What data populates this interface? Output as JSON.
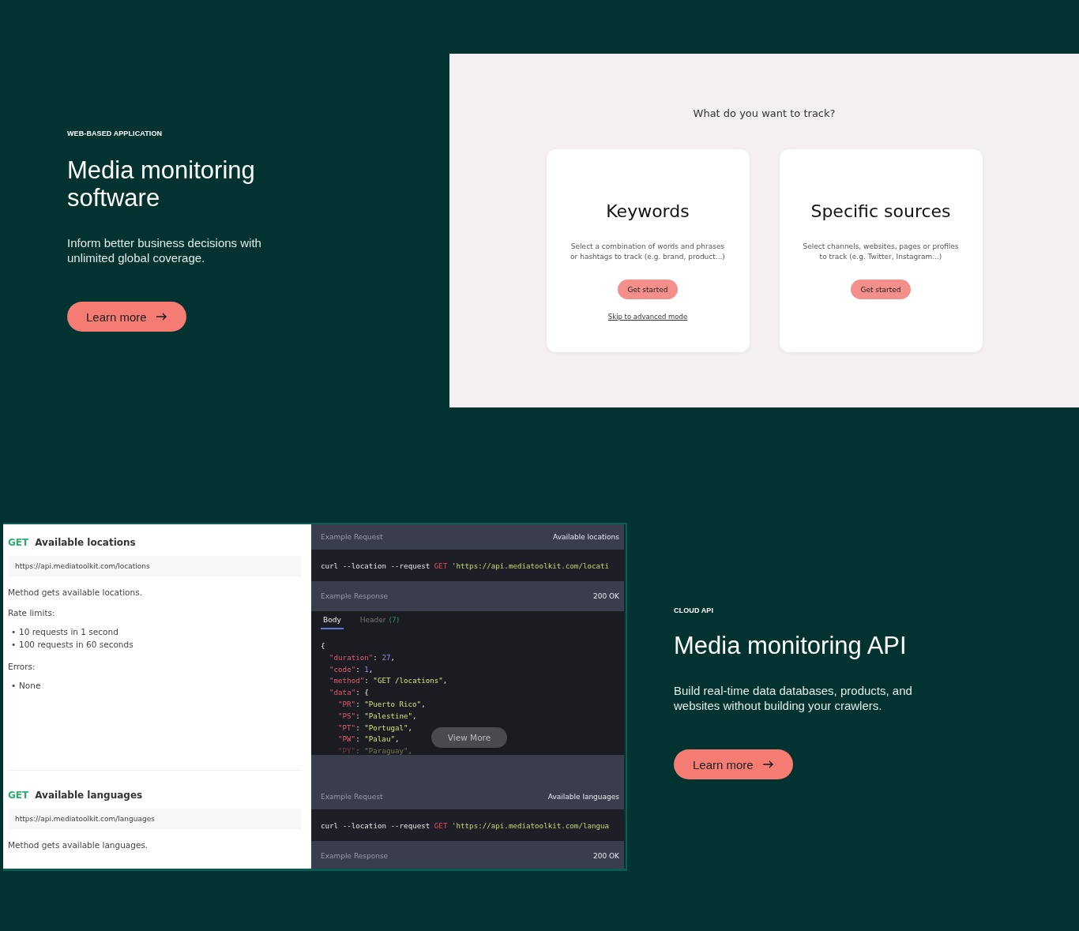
{
  "hero": {
    "eyebrow": "WEB-BASED APPLICATION",
    "title": "Media monitoring software",
    "description": "Inform better business decisions with unlimited global coverage.",
    "button": "Learn more"
  },
  "app_screenshot": {
    "question": "What do you want to track?",
    "cards": [
      {
        "title": "Keywords",
        "description": "Select a combination of words and phrases or hashtags to track (e.g. brand, product...)",
        "button": "Get started",
        "link": "Skip to advanced mode"
      },
      {
        "title": "Specific sources",
        "description": "Select channels, websites, pages or profiles to track (e.g. Twitter, Instagram...)",
        "button": "Get started"
      }
    ]
  },
  "api_screenshot": {
    "endpoints": [
      {
        "method": "GET",
        "name": "Available locations",
        "url": "https://api.mediatoolkit.com/locations",
        "description": "Method gets available locations.",
        "rate_limits_label": "Rate limits:",
        "rate_limits": [
          {
            "bullet": "•",
            "text": "10 requests in 1 second"
          },
          {
            "bullet": "•",
            "text": "100 requests in 60 seconds"
          }
        ],
        "errors_label": "Errors:",
        "errors": [
          {
            "bullet": "•",
            "text": "None"
          }
        ]
      },
      {
        "method": "GET",
        "name": "Available languages",
        "url": "https://api.mediatoolkit.com/languages",
        "description": "Method gets available languages."
      }
    ],
    "examples": [
      {
        "request_label": "Example Request",
        "request_name": "Available locations",
        "curl": "curl --location --request",
        "curl_method": "GET",
        "curl_url": "'https://api.mediatoolkit.com/locati",
        "response_label": "Example Response",
        "status": "200 OK",
        "tabs": [
          {
            "label": "Body",
            "selected": true
          },
          {
            "label": "Header",
            "count": "(7)",
            "selected": false
          }
        ],
        "code": [
          [
            {
              "t": "{",
              "kind": "punct"
            }
          ],
          [
            {
              "t": "\"duration\"",
              "kind": "key"
            },
            {
              "t": ": ",
              "kind": "punct"
            },
            {
              "t": "27",
              "kind": "number"
            },
            {
              "t": ",",
              "kind": "punct"
            }
          ],
          [
            {
              "t": "\"code\"",
              "kind": "key"
            },
            {
              "t": ": ",
              "kind": "punct"
            },
            {
              "t": "1",
              "kind": "number"
            },
            {
              "t": ",",
              "kind": "punct"
            }
          ],
          [
            {
              "t": "\"method\"",
              "kind": "key"
            },
            {
              "t": ": ",
              "kind": "punct"
            },
            {
              "t": "\"GET /locations\"",
              "kind": "string"
            },
            {
              "t": ",",
              "kind": "punct"
            }
          ],
          [
            {
              "t": "\"data\"",
              "kind": "key"
            },
            {
              "t": ": {",
              "kind": "punct"
            }
          ],
          [
            {
              "t": "\"PR\"",
              "kind": "key"
            },
            {
              "t": ": ",
              "kind": "punct"
            },
            {
              "t": "\"Puerto Rico\"",
              "kind": "string"
            },
            {
              "t": ",",
              "kind": "punct"
            }
          ],
          [
            {
              "t": "\"PS\"",
              "kind": "key"
            },
            {
              "t": ": ",
              "kind": "punct"
            },
            {
              "t": "\"Palestine\"",
              "kind": "string"
            },
            {
              "t": ",",
              "kind": "punct"
            }
          ],
          [
            {
              "t": "\"PT\"",
              "kind": "key"
            },
            {
              "t": ": ",
              "kind": "punct"
            },
            {
              "t": "\"Portugal\"",
              "kind": "string"
            },
            {
              "t": ",",
              "kind": "punct"
            }
          ],
          [
            {
              "t": "\"PW\"",
              "kind": "key"
            },
            {
              "t": ": ",
              "kind": "punct"
            },
            {
              "t": "\"Palau\"",
              "kind": "string"
            },
            {
              "t": ",",
              "kind": "punct"
            }
          ],
          [
            {
              "t": "\"PY\"",
              "kind": "key"
            },
            {
              "t": ": ",
              "kind": "punct"
            },
            {
              "t": "\"Paraguay\"",
              "kind": "string"
            },
            {
              "t": ",",
              "kind": "punct"
            }
          ]
        ],
        "view_more": "View More"
      },
      {
        "request_label": "Example Request",
        "request_name": "Available languages",
        "curl": "curl --location --request",
        "curl_method": "GET",
        "curl_url": "'https://api.mediatoolkit.com/langua",
        "response_label": "Example Response",
        "status": "200 OK"
      }
    ]
  },
  "api_section": {
    "eyebrow": "CLOUD API",
    "title": "Media monitoring API",
    "description": "Build real-time data databases, products, and websites without building your crawlers.",
    "button": "Learn more"
  }
}
